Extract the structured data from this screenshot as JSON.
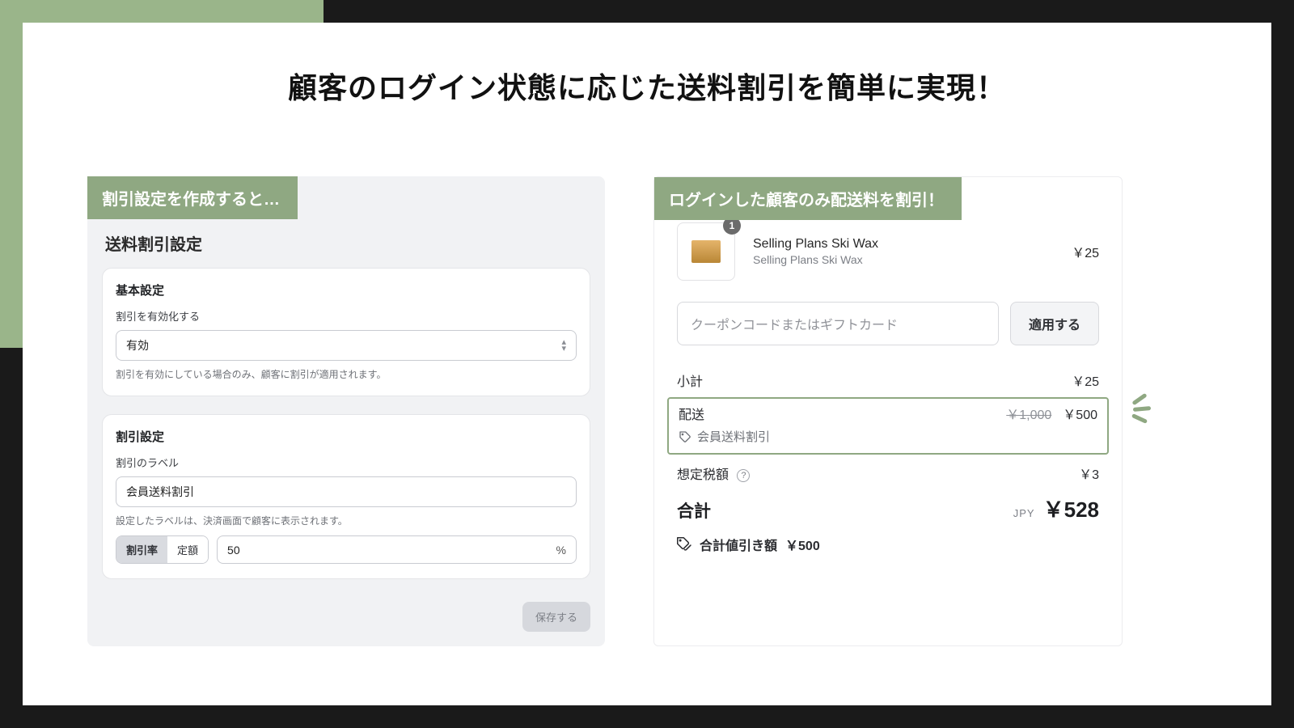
{
  "headline": "顧客のログイン状態に応じた送料割引を簡単に実現！",
  "left": {
    "tag": "割引設定を作成すると…",
    "title": "送料割引設定",
    "card1": {
      "title": "基本設定",
      "enable_label": "割引を有効化する",
      "enable_value": "有効",
      "enable_help": "割引を有効にしている場合のみ、顧客に割引が適用されます。"
    },
    "card2": {
      "title": "割引設定",
      "label_label": "割引のラベル",
      "label_value": "会員送料割引",
      "label_help": "設定したラベルは、決済画面で顧客に表示されます。",
      "seg_rate": "割引率",
      "seg_fixed": "定額",
      "amount": "50",
      "unit": "%"
    },
    "save": "保存する"
  },
  "right": {
    "tag": "ログインした顧客のみ配送料を割引！",
    "item_qty": "1",
    "item_name": "Selling Plans Ski Wax",
    "item_sub": "Selling Plans Ski Wax",
    "item_price": "￥25",
    "coupon_placeholder": "クーポンコードまたはギフトカード",
    "apply": "適用する",
    "subtotal_label": "小計",
    "subtotal_value": "￥25",
    "shipping_label": "配送",
    "shipping_original": "￥1,000",
    "shipping_discounted": "￥500",
    "shipping_tag": "会員送料割引",
    "tax_label": "想定税額",
    "tax_value": "￥3",
    "total_label": "合計",
    "currency": "JPY",
    "total_value": "￥528",
    "savings_label": "合計値引き額",
    "savings_value": "￥500"
  }
}
